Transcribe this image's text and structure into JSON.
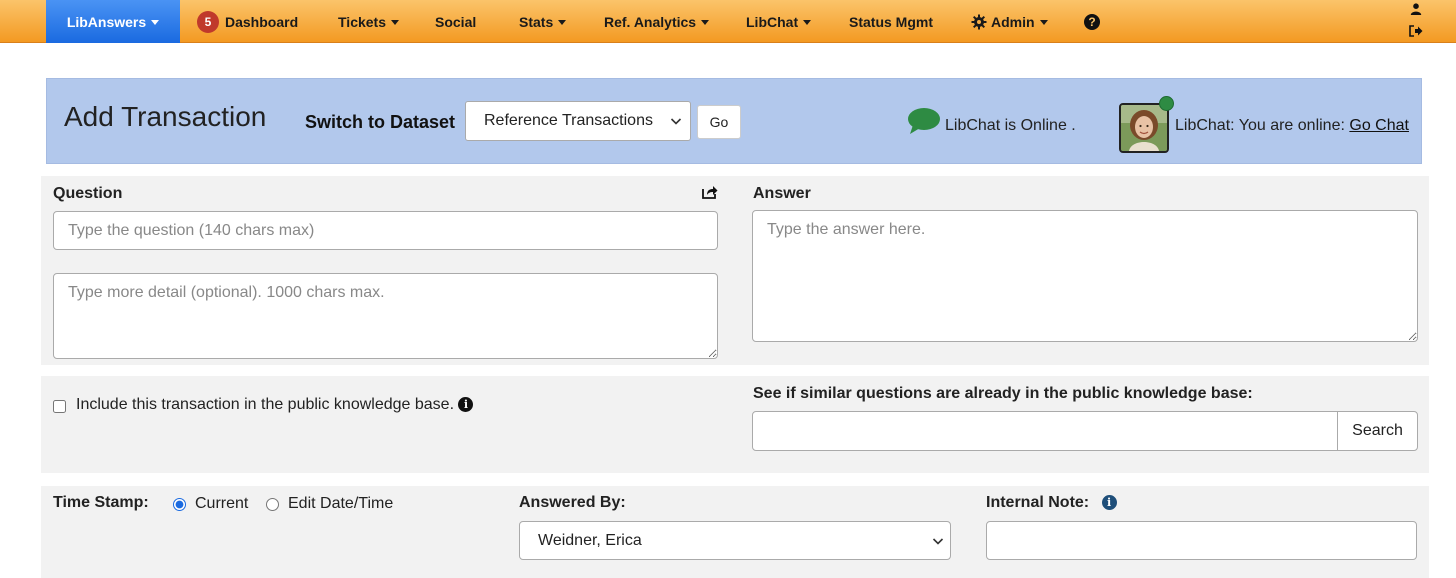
{
  "nav": {
    "brand": "LibAnswers",
    "dashboard_badge": "5",
    "dashboard": "Dashboard",
    "tickets": "Tickets",
    "social": "Social",
    "stats": "Stats",
    "ref_analytics": "Ref. Analytics",
    "libchat": "LibChat",
    "status_mgmt": "Status Mgmt",
    "admin": "Admin",
    "help": "?",
    "accent_color": "#f39a22",
    "brand_color": "#1a6ae0"
  },
  "header": {
    "title": "Add Transaction",
    "switch_label": "Switch to Dataset",
    "dataset_selected": "Reference Transactions",
    "go_label": "Go",
    "chat_status": "LibChat is Online .",
    "online_text": "LibChat: You are online:",
    "go_chat_label": "Go Chat",
    "banner_color": "#b2c8ec"
  },
  "question": {
    "label": "Question",
    "placeholder": "Type the question (140 chars max)",
    "detail_placeholder": "Type more detail (optional). 1000 chars max."
  },
  "answer": {
    "label": "Answer",
    "placeholder": "Type the answer here."
  },
  "kb": {
    "include_label": "Include this transaction in the public knowledge base.",
    "similar_label": "See if similar questions are already in the public knowledge base:",
    "search_value": "",
    "search_button": "Search"
  },
  "meta": {
    "timestamp_label": "Time Stamp:",
    "current_label": "Current",
    "edit_label": "Edit Date/Time",
    "answered_by_label": "Answered By:",
    "answered_by_value": "Weidner, Erica",
    "internal_note_label": "Internal Note:",
    "internal_note_value": ""
  }
}
